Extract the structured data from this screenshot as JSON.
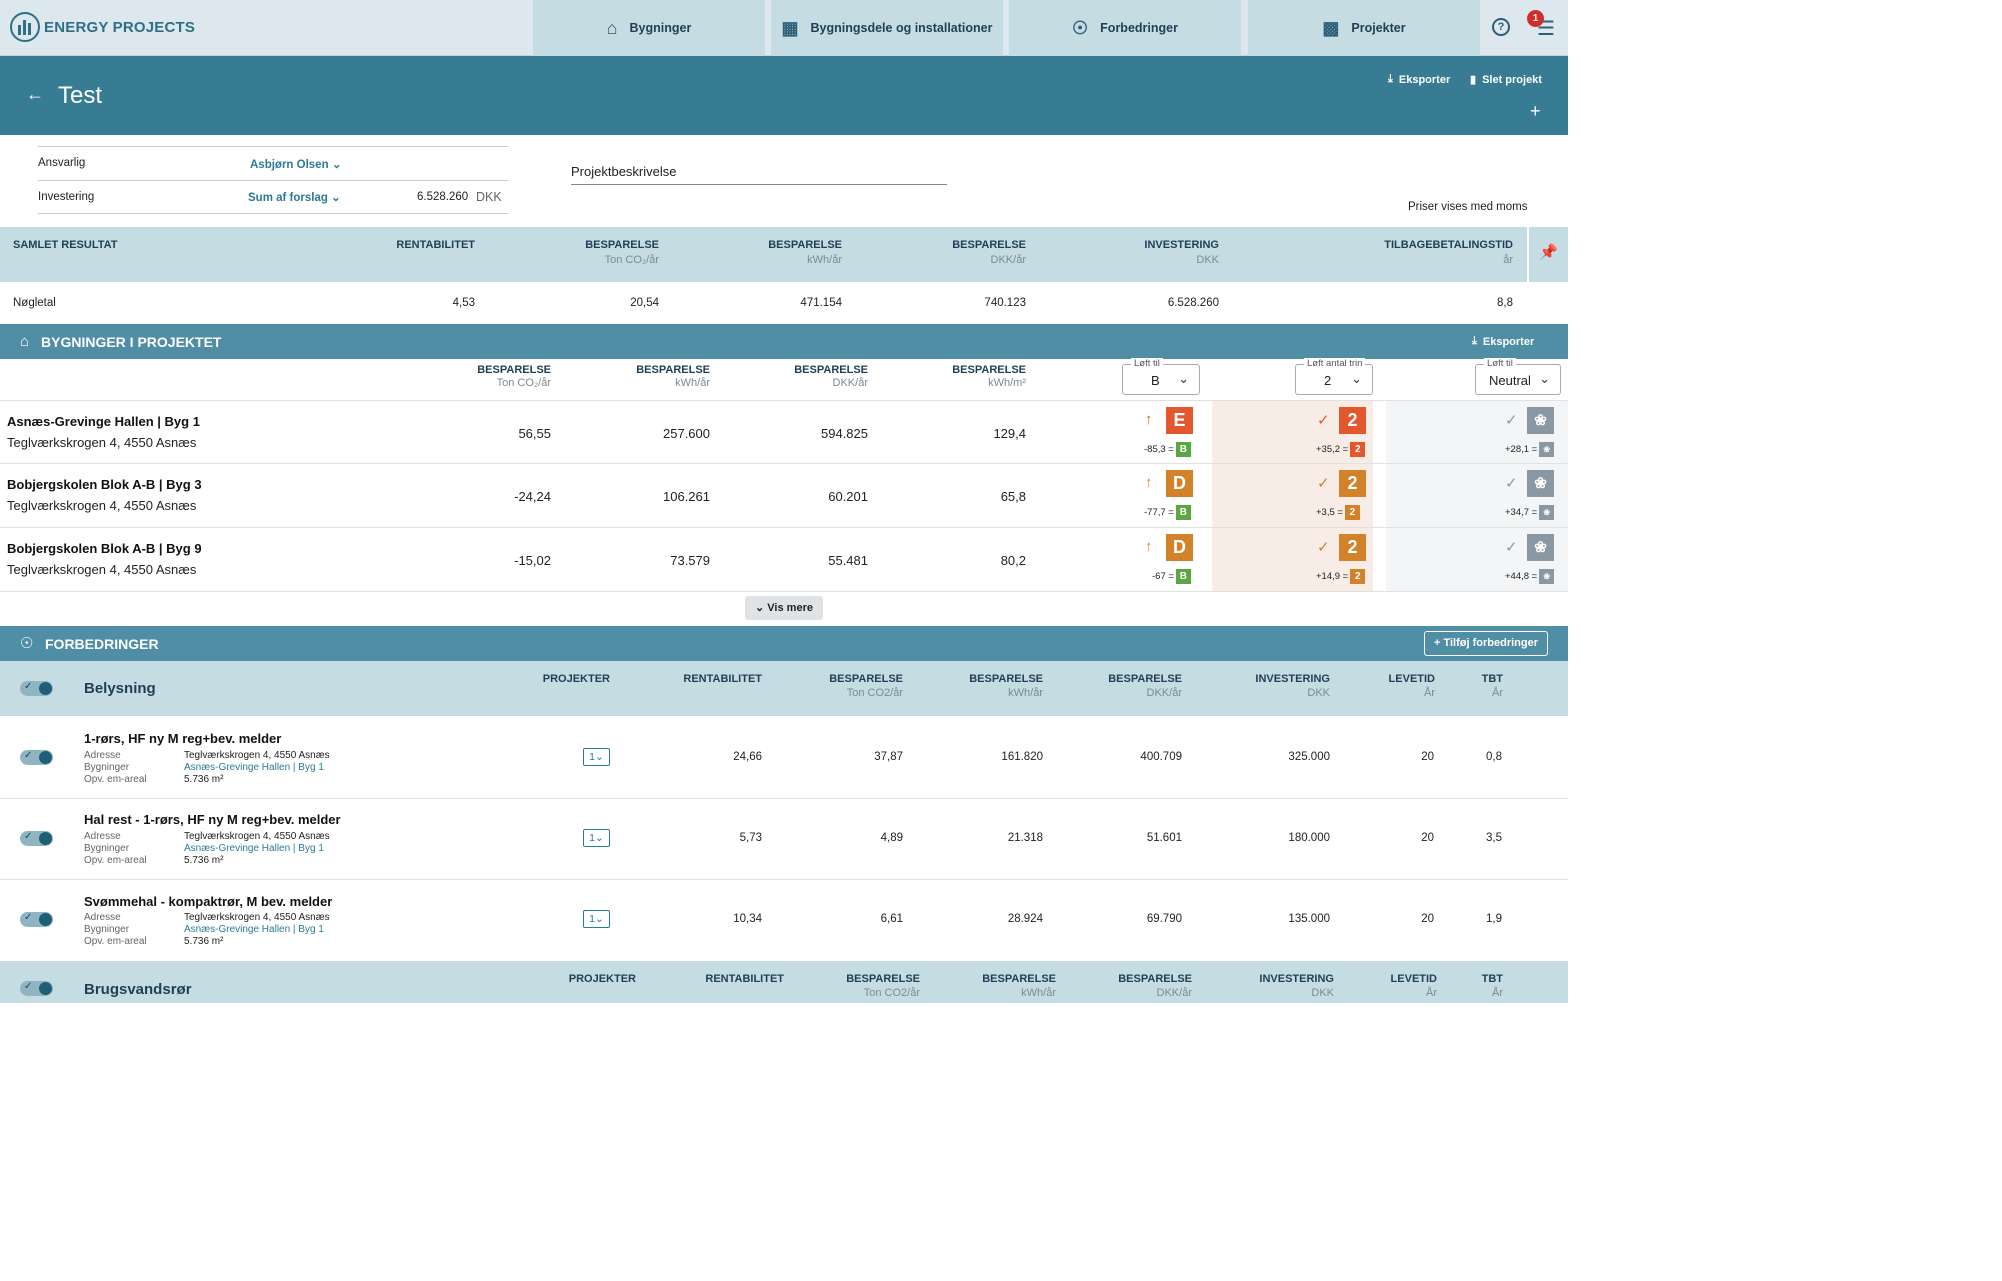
{
  "app": {
    "name": "ENERGY PROJECTS"
  },
  "nav": {
    "tabs": [
      {
        "label": "Bygninger",
        "icon": "home-icon"
      },
      {
        "label": "Bygningsdele og installationer",
        "icon": "bricks-icon"
      },
      {
        "label": "Forbedringer",
        "icon": "lightbulb-icon"
      },
      {
        "label": "Projekter",
        "icon": "blocks-icon"
      }
    ],
    "notification_count": "1"
  },
  "header": {
    "back": "←",
    "title": "Test",
    "export_label": "Eksporter",
    "delete_label": "Slet projekt",
    "add": "+"
  },
  "info": {
    "responsible_label": "Ansvarlig",
    "responsible_value": "Asbjørn Olsen",
    "investment_label": "Investering",
    "investment_mode": "Sum af forslag",
    "investment_amount": "6.528.260",
    "investment_unit": "DKK",
    "description_label": "Projektbeskrivelse",
    "price_note": "Priser vises med moms"
  },
  "summary": {
    "headers": [
      {
        "label": "SAMLET RESULTAT",
        "sub": ""
      },
      {
        "label": "RENTABILITET",
        "sub": ""
      },
      {
        "label": "BESPARELSE",
        "sub": "Ton CO₂/år"
      },
      {
        "label": "BESPARELSE",
        "sub": "kWh/år"
      },
      {
        "label": "BESPARELSE",
        "sub": "DKK/år"
      },
      {
        "label": "INVESTERING",
        "sub": "DKK"
      },
      {
        "label": "TILBAGEBETALINGSTID",
        "sub": "år"
      }
    ],
    "row_label": "Nøgletal",
    "values": [
      "4,53",
      "20,54",
      "471.154",
      "740.123",
      "6.528.260",
      "8,8"
    ]
  },
  "buildings": {
    "title": "BYGNINGER I PROJEKTET",
    "export_label": "Eksporter",
    "headers": [
      {
        "label": "BESPARELSE",
        "sub": "Ton CO₂/år"
      },
      {
        "label": "BESPARELSE",
        "sub": "kWh/år"
      },
      {
        "label": "BESPARELSE",
        "sub": "DKK/år"
      },
      {
        "label": "BESPARELSE",
        "sub": "kWh/m²"
      }
    ],
    "selects": [
      {
        "label": "Løft til",
        "value": "B"
      },
      {
        "label": "Løft antal trin",
        "value": "2"
      },
      {
        "label": "Løft til",
        "value": "Neutral"
      }
    ],
    "rows": [
      {
        "name": "Asnæs-Grevinge Hallen | Byg 1",
        "address": "Teglværkskrogen 4, 4550 Asnæs",
        "co2": "56,55",
        "kwh": "257.600",
        "dkk": "594.825",
        "kwhm2": "129,4",
        "label_cur": "E",
        "label_change": "-85,3 =",
        "label_target": "B",
        "steps": "2",
        "steps_change": "+35,2 =",
        "steps_target": "2",
        "neutral_change": "+28,1 ="
      },
      {
        "name": "Bobjergskolen Blok A-B | Byg 3",
        "address": "Teglværkskrogen 4, 4550 Asnæs",
        "co2": "-24,24",
        "kwh": "106.261",
        "dkk": "60.201",
        "kwhm2": "65,8",
        "label_cur": "D",
        "label_change": "-77,7 =",
        "label_target": "B",
        "steps": "2",
        "steps_change": "+3,5 =",
        "steps_target": "2",
        "neutral_change": "+34,7 ="
      },
      {
        "name": "Bobjergskolen Blok A-B | Byg 9",
        "address": "Teglværkskrogen 4, 4550 Asnæs",
        "co2": "-15,02",
        "kwh": "73.579",
        "dkk": "55.481",
        "kwhm2": "80,2",
        "label_cur": "D",
        "label_change": "-67 =",
        "label_target": "B",
        "steps": "2",
        "steps_change": "+14,9 =",
        "steps_target": "2",
        "neutral_change": "+44,8 ="
      }
    ],
    "show_more": "Vis mere"
  },
  "improvements": {
    "title": "FORBEDRINGER",
    "add_label": "Tilføj forbedringer",
    "headers": [
      {
        "label": "PROJEKTER",
        "sub": ""
      },
      {
        "label": "RENTABILITET",
        "sub": ""
      },
      {
        "label": "BESPARELSE",
        "sub": "Ton CO2/år"
      },
      {
        "label": "BESPARELSE",
        "sub": "kWh/år"
      },
      {
        "label": "BESPARELSE",
        "sub": "DKK/år"
      },
      {
        "label": "INVESTERING",
        "sub": "DKK"
      },
      {
        "label": "LEVETID",
        "sub": "År"
      },
      {
        "label": "TBT",
        "sub": "År"
      }
    ],
    "groups": [
      {
        "name": "Belysning",
        "items": [
          {
            "title": "1-rørs, HF ny M reg+bev. melder",
            "addr_label": "Adresse",
            "addr": "Teglværkskrogen 4, 4550 Asnæs",
            "bld_label": "Bygninger",
            "bld": "Asnæs-Grevinge Hallen | Byg 1",
            "area_label": "Opv. em-areal",
            "area": "5.736 m²",
            "proj": "1",
            "rent": "24,66",
            "co2": "37,87",
            "kwh": "161.820",
            "dkk": "400.709",
            "inv": "325.000",
            "life": "20",
            "tbt": "0,8"
          },
          {
            "title": "Hal rest - 1-rørs, HF ny M reg+bev. melder",
            "addr_label": "Adresse",
            "addr": "Teglværkskrogen 4, 4550 Asnæs",
            "bld_label": "Bygninger",
            "bld": "Asnæs-Grevinge Hallen | Byg 1",
            "area_label": "Opv. em-areal",
            "area": "5.736 m²",
            "proj": "1",
            "rent": "5,73",
            "co2": "4,89",
            "kwh": "21.318",
            "dkk": "51.601",
            "inv": "180.000",
            "life": "20",
            "tbt": "3,5"
          },
          {
            "title": "Svømmehal - kompaktrør, M bev. melder",
            "addr_label": "Adresse",
            "addr": "Teglværkskrogen 4, 4550 Asnæs",
            "bld_label": "Bygninger",
            "bld": "Asnæs-Grevinge Hallen | Byg 1",
            "area_label": "Opv. em-areal",
            "area": "5.736 m²",
            "proj": "1",
            "rent": "10,34",
            "co2": "6,61",
            "kwh": "28.924",
            "dkk": "69.790",
            "inv": "135.000",
            "life": "20",
            "tbt": "1,9"
          }
        ]
      },
      {
        "name": "Brugsvandsrør",
        "items": []
      }
    ]
  },
  "colors": {
    "accent": "#377c93",
    "label_e": "#e2572c",
    "label_d": "#d4822a",
    "label_b": "#5aa642",
    "neutral": "#8a98a3"
  }
}
